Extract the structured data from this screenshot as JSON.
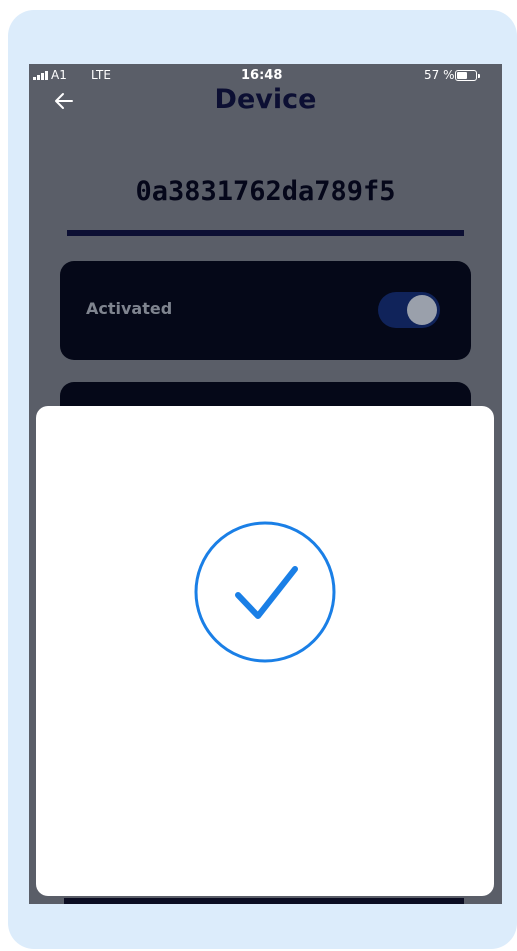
{
  "status_bar": {
    "carrier": "A1",
    "network": "LTE",
    "time": "16:48",
    "battery_percent": "57 %",
    "battery_level": 0.57
  },
  "header": {
    "back_icon": "arrow-left-icon",
    "title": "Device"
  },
  "device": {
    "id": "0a3831762da789f5"
  },
  "settings": {
    "activated_label": "Activated",
    "activated_on": true
  },
  "modal": {
    "icon": "check-circle-icon",
    "accent_color": "#1a7fe6"
  },
  "colors": {
    "frame_background": "#dcecfb",
    "card_background": "#050818",
    "title_color": "#0c0f33"
  }
}
